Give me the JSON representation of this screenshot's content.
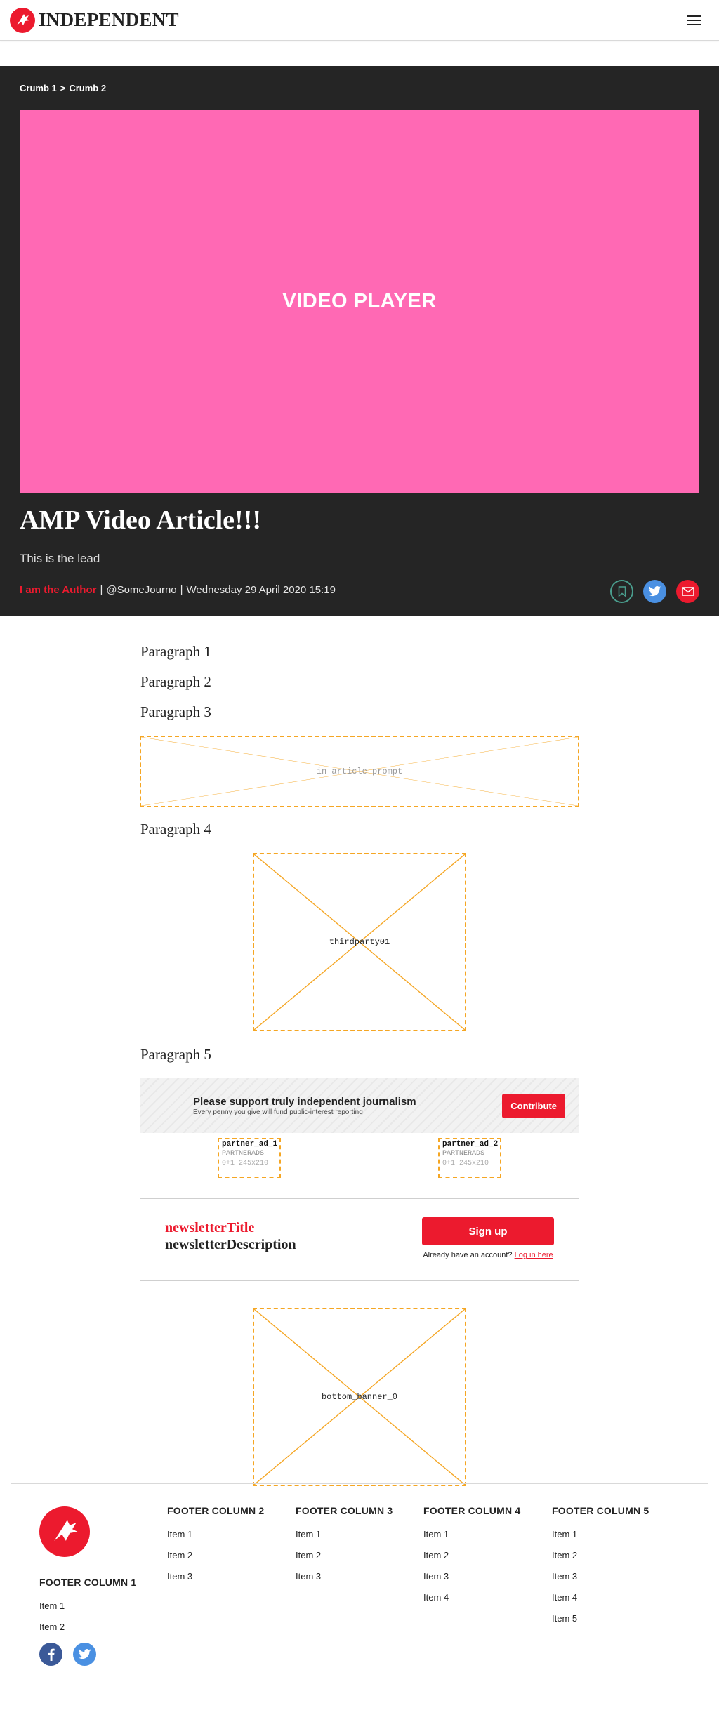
{
  "header": {
    "brand_name": "INDEPENDENT",
    "logo_icon": "eagle-logo-icon",
    "menu_icon": "hamburger-menu-icon",
    "brand_color": "#ec1a2e"
  },
  "hero": {
    "breadcrumbs": [
      "Crumb 1",
      "Crumb 2"
    ],
    "breadcrumb_separator": ">",
    "video_label": "VIDEO PLAYER",
    "video_bg": "#ff69b4",
    "headline": "AMP Video Article!!!",
    "lead": "This is the lead",
    "author": "I am the Author",
    "handle": "@SomeJourno",
    "date": "Wednesday 29 April 2020 15:19",
    "sep": "|",
    "share_icons": [
      "bookmark-icon",
      "twitter-icon",
      "email-icon"
    ]
  },
  "article": {
    "paragraphs": [
      "Paragraph 1",
      "Paragraph 2",
      "Paragraph 3",
      "Paragraph 4",
      "Paragraph 5"
    ],
    "prompt_placeholder": "in article prompt",
    "thirdparty_placeholder": "thirdparty01",
    "support": {
      "title": "Please support truly independent journalism",
      "subtitle": "Every penny you give will fund public-interest reporting",
      "button": "Contribute"
    },
    "partners": [
      {
        "name": "partner_ad_1",
        "label": "PARTNERADS",
        "size": "0+1 245x210"
      },
      {
        "name": "partner_ad_2",
        "label": "PARTNERADS",
        "size": "0+1 245x210"
      }
    ],
    "newsletter": {
      "title": "newsletterTitle",
      "description": "newsletterDescription",
      "signup": "Sign up",
      "account_text": "Already have an account?",
      "login_link": "Log in here"
    },
    "bottom_banner": "bottom_banner_0"
  },
  "footer": {
    "columns": [
      {
        "title": "FOOTER COLUMN 1",
        "items": [
          "Item 1",
          "Item 2"
        ]
      },
      {
        "title": "FOOTER COLUMN 2",
        "items": [
          "Item 1",
          "Item 2",
          "Item 3"
        ]
      },
      {
        "title": "FOOTER COLUMN 3",
        "items": [
          "Item 1",
          "Item 2",
          "Item 3"
        ]
      },
      {
        "title": "FOOTER COLUMN 4",
        "items": [
          "Item 1",
          "Item 2",
          "Item 3",
          "Item 4"
        ]
      },
      {
        "title": "FOOTER COLUMN 5",
        "items": [
          "Item 1",
          "Item 2",
          "Item 3",
          "Item 4",
          "Item 5"
        ]
      }
    ],
    "social_icons": [
      "facebook-icon",
      "twitter-icon"
    ]
  }
}
